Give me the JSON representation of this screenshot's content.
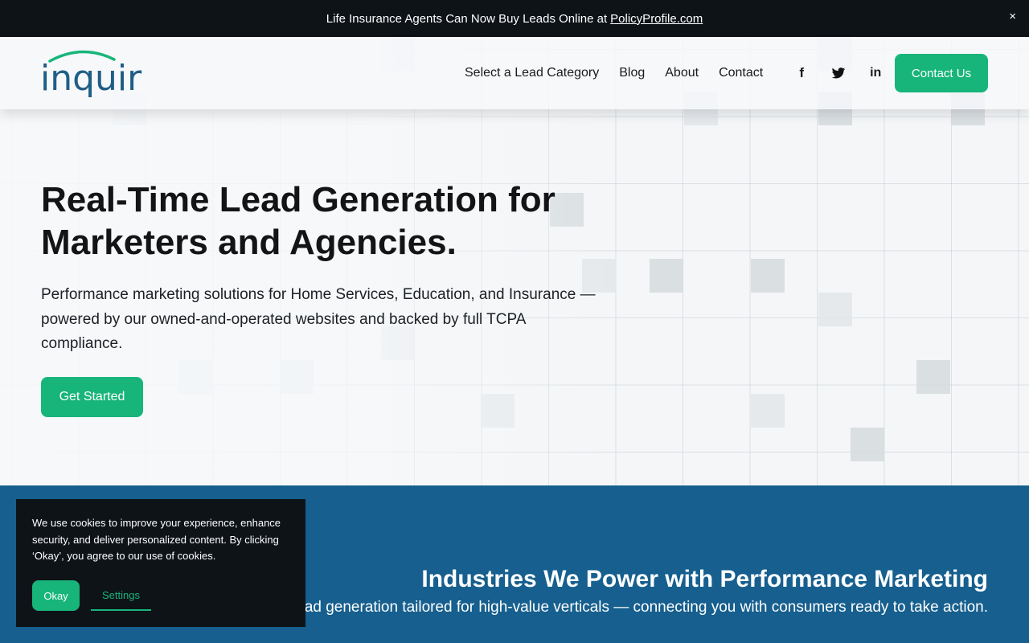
{
  "announcement": {
    "text": "Life Insurance Agents Can Now Buy Leads Online at",
    "link": "PolicyProfile.com",
    "close": "×"
  },
  "header": {
    "logo": "inquir",
    "nav": [
      "Select a Lead Category",
      "Blog",
      "About",
      "Contact"
    ],
    "social": [
      "f",
      "twitter",
      "in"
    ],
    "cta": "Contact Us"
  },
  "hero": {
    "title": "Real-Time Lead Generation for Marketers and Agencies.",
    "subtitle": "Performance marketing solutions for Home Services, Education, and Insurance — powered by our owned-and-operated websites and backed by full TCPA compliance.",
    "cta": "Get Started"
  },
  "industries": {
    "title": "Industries We Power with Performance Marketing",
    "subtitle": "ad generation tailored for high-value verticals — connecting you with consumers ready to take action."
  },
  "cookie": {
    "text": "We use cookies to improve your experience, enhance security, and deliver personalized content. By clicking ‘Okay’, you agree to our use of cookies.",
    "ok": "Okay",
    "settings": "Settings"
  },
  "colors": {
    "accent": "#17b57a",
    "brand_blue": "#1f5e86",
    "section_blue": "#165f8e",
    "dark": "#0e1318"
  }
}
